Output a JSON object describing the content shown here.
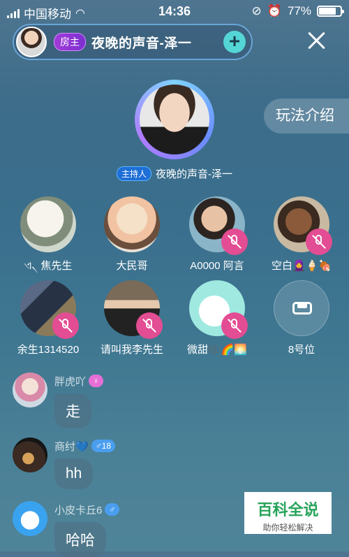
{
  "status_bar": {
    "carrier": "中国移动",
    "time": "14:36",
    "battery": "77%",
    "battery_level": 0.77
  },
  "room": {
    "owner_badge": "房主",
    "name": "夜晚的声音-泽一",
    "add_icon": "plus-icon",
    "close_icon": "close-icon"
  },
  "rules_button": "玩法介绍",
  "host": {
    "badge": "主持人",
    "name": "夜晚的声音-泽一"
  },
  "seats": [
    {
      "name": "ଏ৲ 焦先生",
      "muted": false
    },
    {
      "name": "大民哥",
      "muted": false
    },
    {
      "name": "A0000  阿言",
      "muted": true
    },
    {
      "name": "空白🧕🍦🍖",
      "muted": true
    },
    {
      "name": "余生1314520",
      "muted": true
    },
    {
      "name": "请叫我李先生",
      "muted": true
    },
    {
      "name": "微甜🎼🌈🌅",
      "muted": true
    },
    {
      "name": "8号位",
      "empty": true,
      "icon": "sofa-icon"
    }
  ],
  "messages": [
    {
      "user": "胖虎吖",
      "tag": "♀",
      "tag_color": "#e66fd6",
      "text": "走"
    },
    {
      "user": "商纣💙",
      "tag": "♂18",
      "tag_color": "#4a9ef0",
      "text": "hh"
    },
    {
      "user": "小皮卡丘6",
      "tag": "♂",
      "tag_color": "#4a9ef0",
      "text": "哈哈"
    }
  ],
  "watermark": {
    "title": "百科全说",
    "subtitle": "助你轻松解决"
  }
}
